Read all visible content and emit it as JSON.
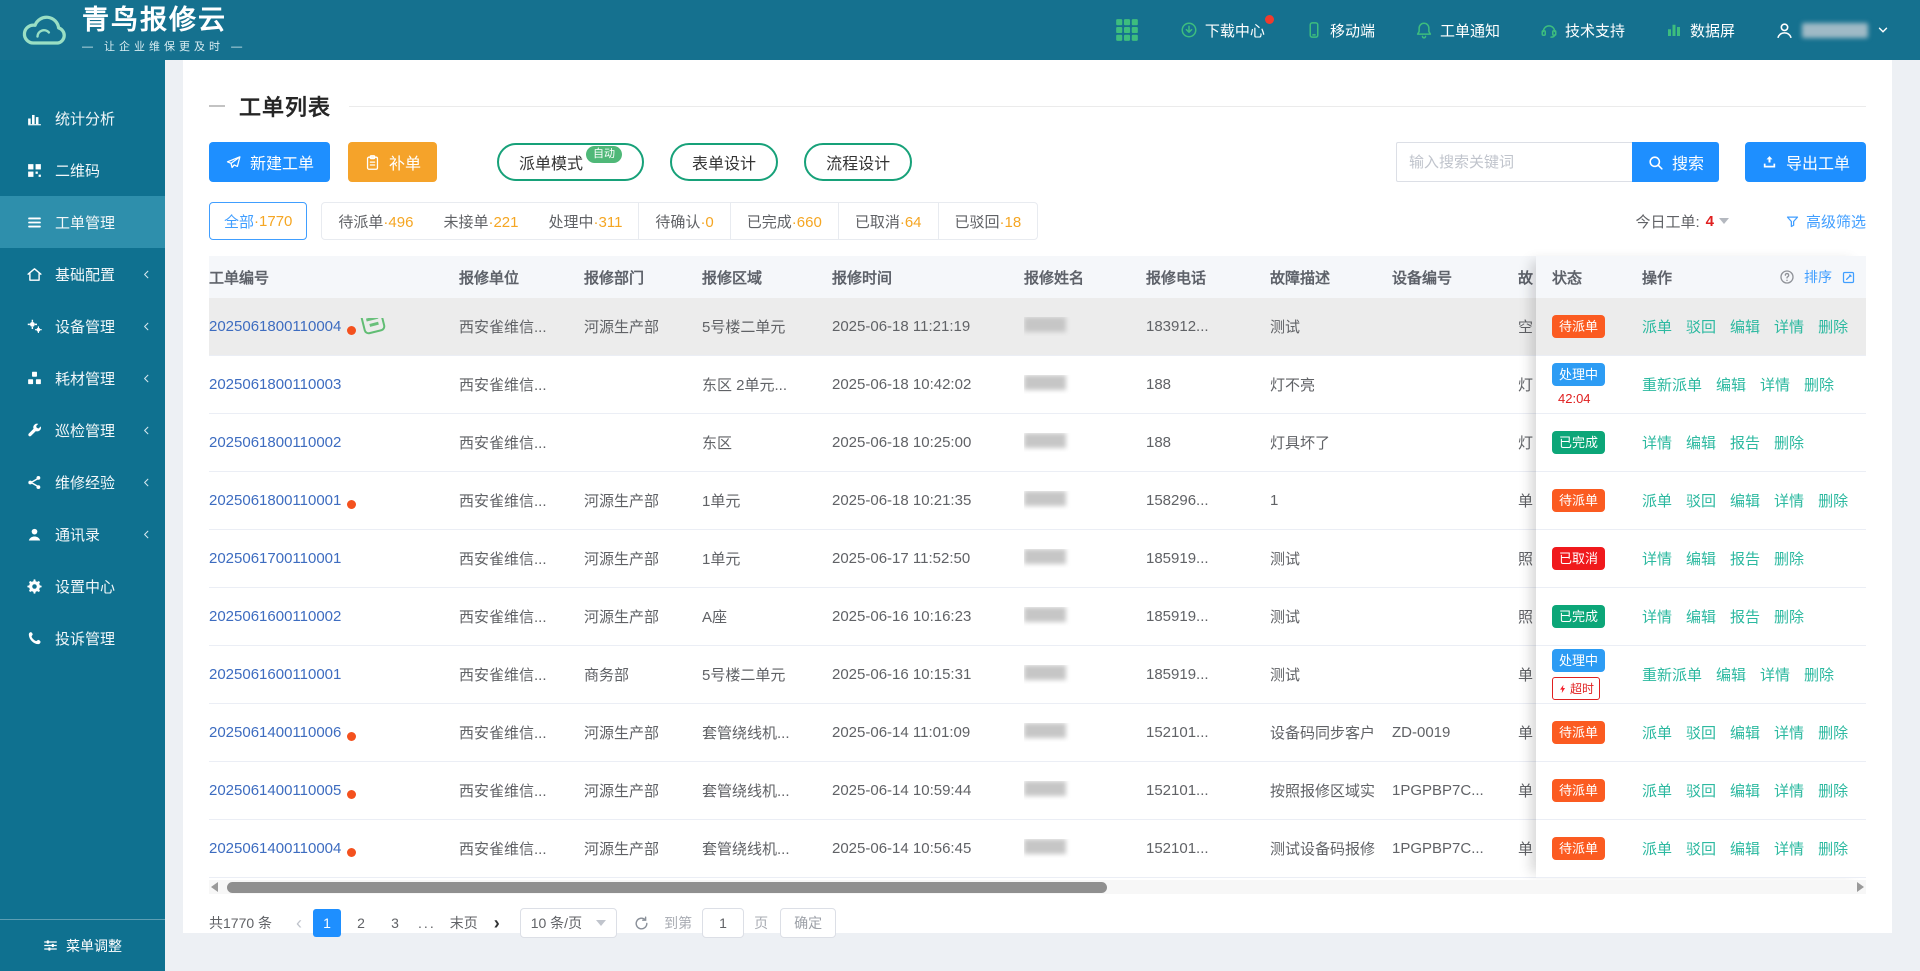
{
  "colors": {
    "header_teal": "#15718F",
    "sidebar_teal": "#0F7190",
    "accent_green": "#3DBD7E",
    "primary_blue": "#1E8FFF",
    "warn_orange": "#F5A32A",
    "pill_border_green": "#17A179",
    "count_orange": "#F5A623",
    "order_link_blue": "#3D6CC0",
    "action_teal": "#2CB9A0",
    "status_pending": "#FB5B21",
    "status_processing": "#2D9CF4",
    "status_done": "#0CA678",
    "status_cancelled": "#F0191C",
    "alert_red": "#E02020"
  },
  "topbar": {
    "logo_title": "青鸟报修云",
    "logo_tagline": "— 让企业维保更及时 —",
    "menu": [
      {
        "label": "下载中心",
        "icon": "download-icon",
        "dot": true
      },
      {
        "label": "移动端",
        "icon": "mobile-icon"
      },
      {
        "label": "工单通知",
        "icon": "bell-icon"
      },
      {
        "label": "技术支持",
        "icon": "headset-icon"
      },
      {
        "label": "数据屏",
        "icon": "chart-icon"
      }
    ]
  },
  "sidebar": {
    "items": [
      {
        "label": "统计分析",
        "icon": "stats-icon"
      },
      {
        "label": "二维码",
        "icon": "qrcode-icon"
      },
      {
        "label": "工单管理",
        "icon": "menu-icon",
        "active": true
      },
      {
        "label": "基础配置",
        "icon": "home-icon",
        "expandable": true
      },
      {
        "label": "设备管理",
        "icon": "gears-icon",
        "expandable": true
      },
      {
        "label": "耗材管理",
        "icon": "boxes-icon",
        "expandable": true
      },
      {
        "label": "巡检管理",
        "icon": "wrench-icon",
        "expandable": true
      },
      {
        "label": "维修经验",
        "icon": "share-icon",
        "expandable": true
      },
      {
        "label": "通讯录",
        "icon": "contacts-icon",
        "expandable": true
      },
      {
        "label": "设置中心",
        "icon": "settings-icon"
      },
      {
        "label": "投诉管理",
        "icon": "phone-icon"
      }
    ],
    "footer_label": "菜单调整"
  },
  "page": {
    "title": "工单列表",
    "buttons": {
      "new_order": "新建工单",
      "supplement": "补单",
      "dispatch_mode": "派单模式",
      "dispatch_badge": "自动",
      "form_design": "表单设计",
      "flow_design": "流程设计"
    },
    "search": {
      "placeholder": "输入搜索关键词",
      "button": "搜索",
      "export": "导出工单"
    },
    "tabs": [
      {
        "label": "全部",
        "count": "1770",
        "active": true
      },
      {
        "label": "待派单",
        "count": "496"
      },
      {
        "label": "未接单",
        "count": "221"
      },
      {
        "label": "处理中",
        "count": "311"
      },
      {
        "label": "待确认",
        "count": "0"
      },
      {
        "label": "已完成",
        "count": "660"
      },
      {
        "label": "已取消",
        "count": "64"
      },
      {
        "label": "已驳回",
        "count": "18"
      }
    ],
    "today_label": "今日工单:",
    "today_count": "4",
    "advanced_filter": "高级筛选"
  },
  "table": {
    "columns": [
      "工单编号",
      "报修单位",
      "报修部门",
      "报修区域",
      "报修时间",
      "报修姓名",
      "报修电话",
      "故障描述",
      "设备编号",
      "故"
    ],
    "status_col": "状态",
    "action_col": "操作",
    "sort_label": "排序",
    "rows": [
      {
        "order_no": "2025061800110004",
        "unread_dot": true,
        "stamp": true,
        "unit": "西安雀维信...",
        "dept": "河源生产部",
        "area": "5号楼二单元",
        "time": "2025-06-18 11:21:19",
        "name_masked": true,
        "phone": "183912...",
        "fault": "测试",
        "device": "",
        "fault_type_clip": "空",
        "status": {
          "label": "待派单",
          "type": "pending"
        },
        "actions": [
          "派单",
          "驳回",
          "编辑",
          "详情",
          "删除"
        ],
        "highlighted": true
      },
      {
        "order_no": "2025061800110003",
        "unit": "西安雀维信...",
        "dept": "",
        "area": "东区 2单元...",
        "time": "2025-06-18 10:42:02",
        "name_masked": true,
        "phone": "188",
        "fault": "灯不亮",
        "device": "",
        "fault_type_clip": "灯",
        "status": {
          "label": "处理中",
          "type": "processing",
          "timer": "42:04"
        },
        "actions": [
          "重新派单",
          "编辑",
          "详情",
          "删除"
        ]
      },
      {
        "order_no": "2025061800110002",
        "unit": "西安雀维信...",
        "dept": "",
        "area": "东区",
        "time": "2025-06-18 10:25:00",
        "name_masked": true,
        "phone": "188",
        "fault": "灯具坏了",
        "device": "",
        "fault_type_clip": "灯",
        "status": {
          "label": "已完成",
          "type": "done"
        },
        "actions": [
          "详情",
          "编辑",
          "报告",
          "删除"
        ]
      },
      {
        "order_no": "2025061800110001",
        "unread_dot": true,
        "unit": "西安雀维信...",
        "dept": "河源生产部",
        "area": "1单元",
        "time": "2025-06-18 10:21:35",
        "name_masked": true,
        "phone": "158296...",
        "fault": "1",
        "device": "",
        "fault_type_clip": "单",
        "status": {
          "label": "待派单",
          "type": "pending"
        },
        "actions": [
          "派单",
          "驳回",
          "编辑",
          "详情",
          "删除"
        ]
      },
      {
        "order_no": "2025061700110001",
        "unit": "西安雀维信...",
        "dept": "河源生产部",
        "area": "1单元",
        "time": "2025-06-17 11:52:50",
        "name_masked": true,
        "phone": "185919...",
        "fault": "测试",
        "device": "",
        "fault_type_clip": "照",
        "status": {
          "label": "已取消",
          "type": "cancelled"
        },
        "actions": [
          "详情",
          "编辑",
          "报告",
          "删除"
        ]
      },
      {
        "order_no": "2025061600110002",
        "unit": "西安雀维信...",
        "dept": "河源生产部",
        "area": "A座",
        "time": "2025-06-16 10:16:23",
        "name_masked": true,
        "phone": "185919...",
        "fault": "测试",
        "device": "",
        "fault_type_clip": "照",
        "status": {
          "label": "已完成",
          "type": "done"
        },
        "actions": [
          "详情",
          "编辑",
          "报告",
          "删除"
        ]
      },
      {
        "order_no": "2025061600110001",
        "unit": "西安雀维信...",
        "dept": "商务部",
        "area": "5号楼二单元",
        "time": "2025-06-16 10:15:31",
        "name_masked": true,
        "phone": "185919...",
        "fault": "测试",
        "device": "",
        "fault_type_clip": "单",
        "status": {
          "label": "处理中",
          "type": "processing",
          "overtime": "超时"
        },
        "actions": [
          "重新派单",
          "编辑",
          "详情",
          "删除"
        ]
      },
      {
        "order_no": "2025061400110006",
        "unread_dot": true,
        "unit": "西安雀维信...",
        "dept": "河源生产部",
        "area": "套管绕线机...",
        "time": "2025-06-14 11:01:09",
        "name_masked": true,
        "phone": "152101...",
        "fault": "设备码同步客户",
        "device": "ZD-0019",
        "fault_type_clip": "单",
        "status": {
          "label": "待派单",
          "type": "pending"
        },
        "actions": [
          "派单",
          "驳回",
          "编辑",
          "详情",
          "删除"
        ]
      },
      {
        "order_no": "2025061400110005",
        "unread_dot": true,
        "unit": "西安雀维信...",
        "dept": "河源生产部",
        "area": "套管绕线机...",
        "time": "2025-06-14 10:59:44",
        "name_masked": true,
        "phone": "152101...",
        "fault": "按照报修区域实",
        "device": "1PGPBP7C...",
        "fault_type_clip": "单",
        "status": {
          "label": "待派单",
          "type": "pending"
        },
        "actions": [
          "派单",
          "驳回",
          "编辑",
          "详情",
          "删除"
        ]
      },
      {
        "order_no": "2025061400110004",
        "unread_dot": true,
        "unit": "西安雀维信...",
        "dept": "河源生产部",
        "area": "套管绕线机...",
        "time": "2025-06-14 10:56:45",
        "name_masked": true,
        "phone": "152101...",
        "fault": "测试设备码报修",
        "device": "1PGPBP7C...",
        "fault_type_clip": "单",
        "status": {
          "label": "待派单",
          "type": "pending"
        },
        "actions": [
          "派单",
          "驳回",
          "编辑",
          "详情",
          "删除"
        ]
      }
    ]
  },
  "pagination": {
    "total": "共1770 条",
    "pages": [
      "1",
      "2",
      "3"
    ],
    "active_page": "1",
    "ellipsis": "...",
    "last_label": "末页",
    "per_page": "10 条/页",
    "goto_prefix": "到第",
    "goto_value": "1",
    "goto_suffix": "页",
    "confirm": "确定"
  }
}
